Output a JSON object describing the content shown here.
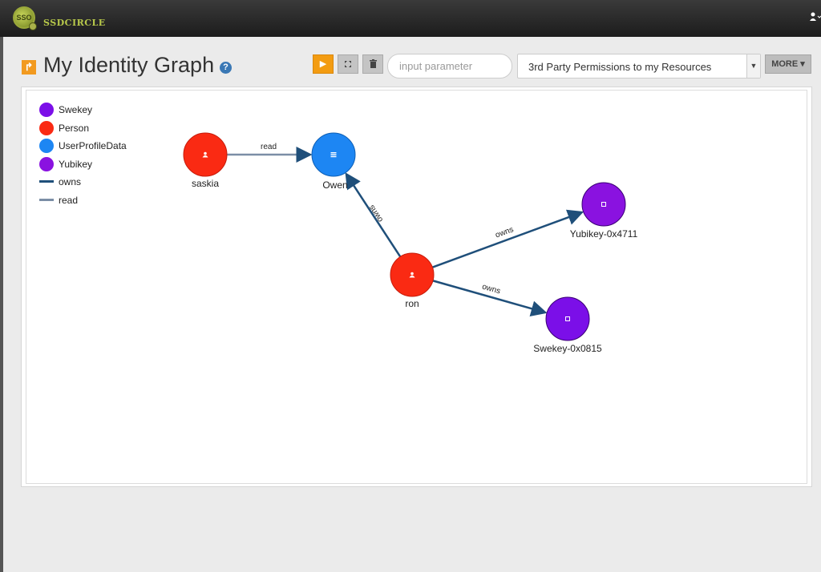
{
  "navbar": {
    "logo_text": "SSO",
    "brand": "SSDCIRCLE",
    "user_icon": "user-icon"
  },
  "header": {
    "title": "My Identity Graph",
    "help": "?"
  },
  "toolbar": {
    "play_icon": "▶",
    "expand_icon": "⤧",
    "trash_icon": "🗑",
    "param_placeholder": "input parameter",
    "param_value": "",
    "query_selected": "3rd Party Permissions to my Resources",
    "more_label": "MORE ▾"
  },
  "colors": {
    "Swekey": "#7b0fe8",
    "Person": "#fa2a13",
    "UserProfileData": "#1d86f3",
    "Yubikey": "#8a12e0",
    "owns": "#1f4f7a",
    "read": "#7b8ea6"
  },
  "legend": [
    {
      "label": "Swekey",
      "kind": "node",
      "color": "#7b0fe8"
    },
    {
      "label": "Person",
      "kind": "node",
      "color": "#fa2a13"
    },
    {
      "label": "UserProfileData",
      "kind": "node",
      "color": "#1d86f3"
    },
    {
      "label": "Yubikey",
      "kind": "node",
      "color": "#8a12e0"
    },
    {
      "label": "owns",
      "kind": "edge",
      "color": "#1f4f7a"
    },
    {
      "label": "read",
      "kind": "edge",
      "color": "#7b8ea6"
    }
  ],
  "graph": {
    "nodes": [
      {
        "id": "saskia",
        "label": "saskia",
        "type": "Person",
        "icon": "person-icon"
      },
      {
        "id": "owen",
        "label": "Owen",
        "type": "UserProfileData",
        "icon": "list-icon"
      },
      {
        "id": "ron",
        "label": "ron",
        "type": "Person",
        "icon": "person-icon"
      },
      {
        "id": "yubikey",
        "label": "Yubikey-0x4711",
        "type": "Yubikey",
        "icon": "square-icon"
      },
      {
        "id": "swekey",
        "label": "Swekey-0x0815",
        "type": "Swekey",
        "icon": "square-icon"
      }
    ],
    "edges": [
      {
        "from": "saskia",
        "to": "owen",
        "label": "read"
      },
      {
        "from": "ron",
        "to": "owen",
        "label": "owns"
      },
      {
        "from": "ron",
        "to": "yubikey",
        "label": "owns"
      },
      {
        "from": "ron",
        "to": "swekey",
        "label": "owns"
      }
    ]
  }
}
